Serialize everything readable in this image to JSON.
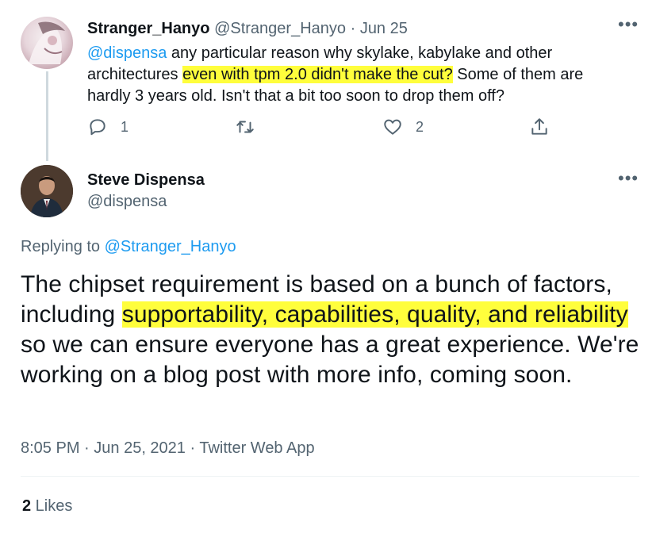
{
  "reply_tweet": {
    "display_name": "Stranger_Hanyo",
    "handle": "@Stranger_Hanyo",
    "separator": "·",
    "date": "Jun 25",
    "text_mention": "@dispensa",
    "text_part1": " any particular reason why skylake, kabylake and other architectures ",
    "text_highlight": "even with tpm 2.0 didn't make the cut?",
    "text_part2": " Some of them are hardly 3 years old. Isn't that a bit too soon to drop them off?",
    "replies_count": "1",
    "likes_count": "2",
    "more_label": "•••"
  },
  "main_tweet": {
    "display_name": "Steve Dispensa",
    "handle": "@dispensa",
    "more_label": "•••",
    "replying_prefix": "Replying to ",
    "replying_handle": "@Stranger_Hanyo",
    "text_part1": "The chipset requirement is based on a bunch of factors, including ",
    "text_highlight": "supportability, capabilities, quality, and reliability",
    "text_part2": " so we can ensure everyone has a great experience. We're working on a blog post with more info, coming soon.",
    "time": "8:05 PM",
    "separator1": " · ",
    "date": "Jun 25, 2021",
    "separator2": " · ",
    "source": "Twitter Web App",
    "likes_count": "2",
    "likes_label": " Likes"
  },
  "colors": {
    "link": "#1d9bf0",
    "highlight": "#fffe3c",
    "muted": "#536471",
    "text": "#0f1419"
  },
  "icons": [
    "reply-icon",
    "retweet-icon",
    "like-icon",
    "share-icon",
    "more-icon"
  ]
}
